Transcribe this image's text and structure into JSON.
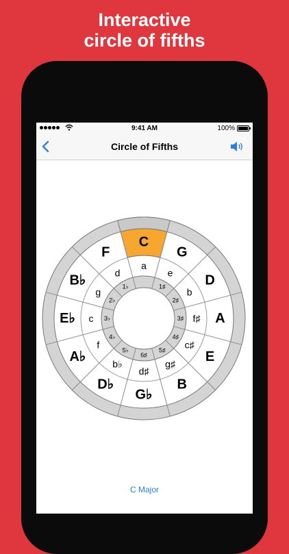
{
  "promo": {
    "line1": "Interactive",
    "line2": "circle of fifths"
  },
  "status_bar": {
    "time": "9:41 AM",
    "battery": "100%"
  },
  "nav": {
    "title": "Circle of Fifths",
    "back_icon": "chevron-left-icon",
    "sound_icon": "speaker-icon"
  },
  "circle": {
    "selected": "C",
    "major_keys": [
      "C",
      "G",
      "D",
      "A",
      "E",
      "B",
      "G♭",
      "D♭",
      "A♭",
      "E♭",
      "B♭",
      "F"
    ],
    "minor_keys": [
      "a",
      "e",
      "b",
      "f♯",
      "c♯",
      "g♯",
      "d♯",
      "b♭",
      "f",
      "c",
      "g",
      "d"
    ],
    "signatures": [
      "",
      "1♯",
      "2♯",
      "3♯",
      "4♯",
      "5♯",
      "6♯",
      "5♭",
      "4♭",
      "3♭",
      "2♭",
      "1♭"
    ]
  },
  "colors": {
    "background": "#e0373e",
    "selected": "#f7a630",
    "ring": "#d4d4d4",
    "accent": "#2f7ee5"
  },
  "key_label": "C Major"
}
